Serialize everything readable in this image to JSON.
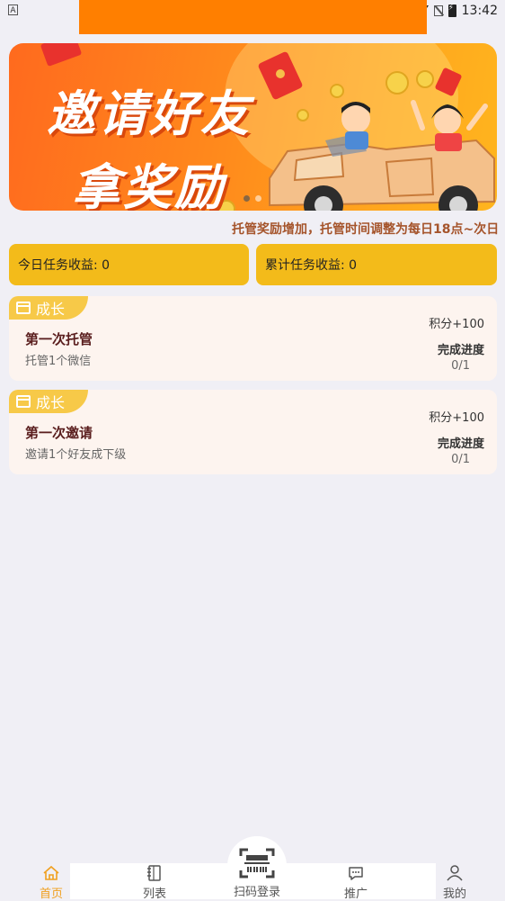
{
  "status_bar": {
    "time": "13:42",
    "left_icon_text": "A"
  },
  "banner": {
    "line1": "邀请好友",
    "line2": "拿奖励",
    "page_count": 2,
    "active_page": 1
  },
  "marquee": {
    "text": "托管奖励增加，托管时间调整为每日18点~次日"
  },
  "stats": {
    "today_label": "今日任务收益: 0",
    "total_label": "累计任务收益: 0"
  },
  "tasks": [
    {
      "tag": "成长",
      "title": "第一次托管",
      "desc": "托管1个微信",
      "points": "积分+100",
      "progress_label": "完成进度",
      "progress": "0/1"
    },
    {
      "tag": "成长",
      "title": "第一次邀请",
      "desc": "邀请1个好友成下级",
      "points": "积分+100",
      "progress_label": "完成进度",
      "progress": "0/1"
    }
  ],
  "nav": {
    "home": "首页",
    "list": "列表",
    "scan": "扫码登录",
    "promote": "推广",
    "mine": "我的"
  },
  "colors": {
    "accent_orange": "#ff7f00",
    "stat_yellow": "#f3bb1a",
    "tag_yellow": "#f7c948",
    "nav_active": "#f0a020"
  }
}
